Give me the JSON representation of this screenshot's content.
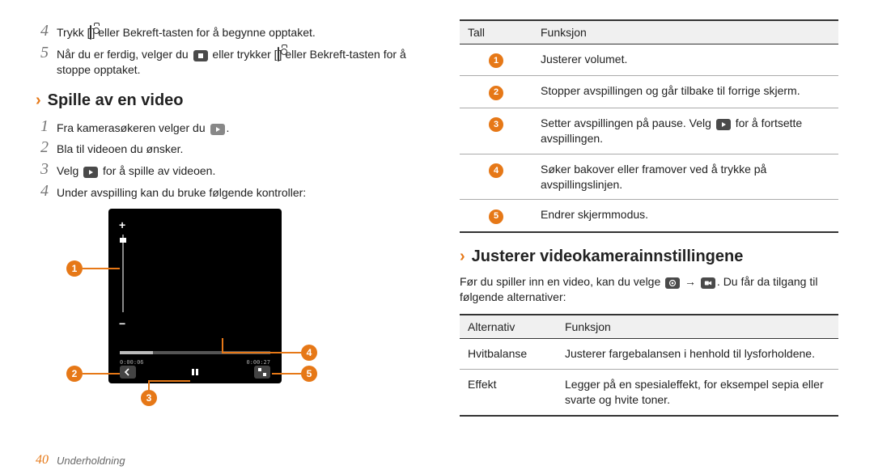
{
  "left": {
    "step4": "Trykk [📷] eller Bekreft-tasten for å begynne opptaket.",
    "step5": "Når du er ferdig, velger du ▢ eller trykker [📷] eller Bekreft-tasten for å stoppe opptaket.",
    "heading_play": "Spille av en video",
    "play_steps": {
      "s1": "Fra kamerasøkeren velger du ▶.",
      "s2": "Bla til videoen du ønsker.",
      "s3a": "Velg ",
      "s3b": " for å spille av videoen.",
      "s4": "Under avspilling kan du bruke følgende kontroller:"
    },
    "time_current": "0:00:06",
    "time_duration": "0:00:27"
  },
  "right": {
    "table1": {
      "h1": "Tall",
      "h2": "Funksjon",
      "rows": [
        "Justerer volumet.",
        "Stopper avspillingen og går tilbake til forrige skjerm.",
        "Setter avspillingen på pause. Velg ▶ for å fortsette avspillingen.",
        "Søker bakover eller framover ved å trykke på avspillingslinjen.",
        "Endrer skjermmodus."
      ]
    },
    "heading_adjust": "Justerer videokamerainnstillingene",
    "adjust_desc_a": "Før du spiller inn en video, kan du velge ",
    "adjust_desc_b": " → ",
    "adjust_desc_c": ". Du får da tilgang til følgende alternativer:",
    "table2": {
      "h1": "Alternativ",
      "h2": "Funksjon",
      "rows": [
        {
          "k": "Hvitbalanse",
          "v": "Justerer fargebalansen i henhold til lysforholdene."
        },
        {
          "k": "Effekt",
          "v": "Legger på en spesialeffekt, for eksempel sepia eller svarte og hvite toner."
        }
      ]
    }
  },
  "footer": {
    "page": "40",
    "section": "Underholdning"
  }
}
